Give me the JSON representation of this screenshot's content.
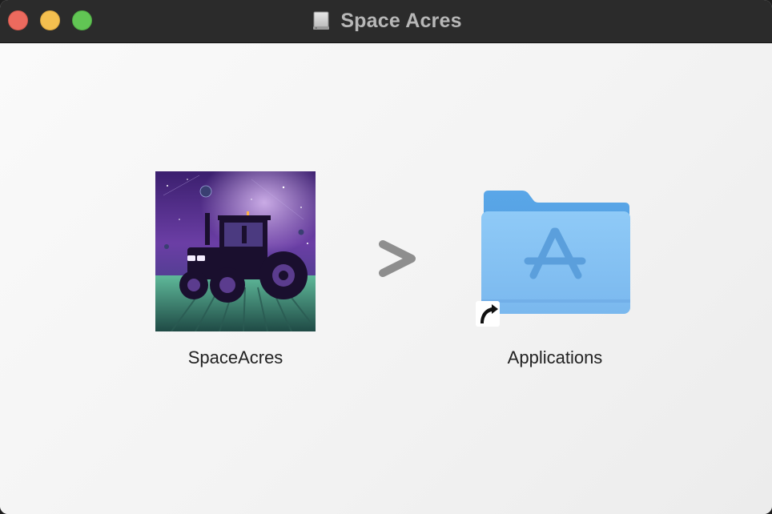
{
  "window": {
    "title": "Space Acres",
    "title_icon": "external-disk-icon"
  },
  "traffic_lights": {
    "close_color": "#ec6a5e",
    "minimize_color": "#f4bf4f",
    "zoom_color": "#61c554"
  },
  "installer": {
    "app": {
      "label": "SpaceAcres",
      "icon": "tractor-space-artwork-icon"
    },
    "arrow": {
      "glyph": ">",
      "icon": "drag-arrow-icon"
    },
    "target": {
      "label": "Applications",
      "icon": "applications-folder-icon",
      "alias_badge": "alias-arrow-icon"
    }
  },
  "colors": {
    "titlebar": "#2b2b2b",
    "background": "#f2f2f2",
    "folder_blue": "#7cbdf0"
  }
}
